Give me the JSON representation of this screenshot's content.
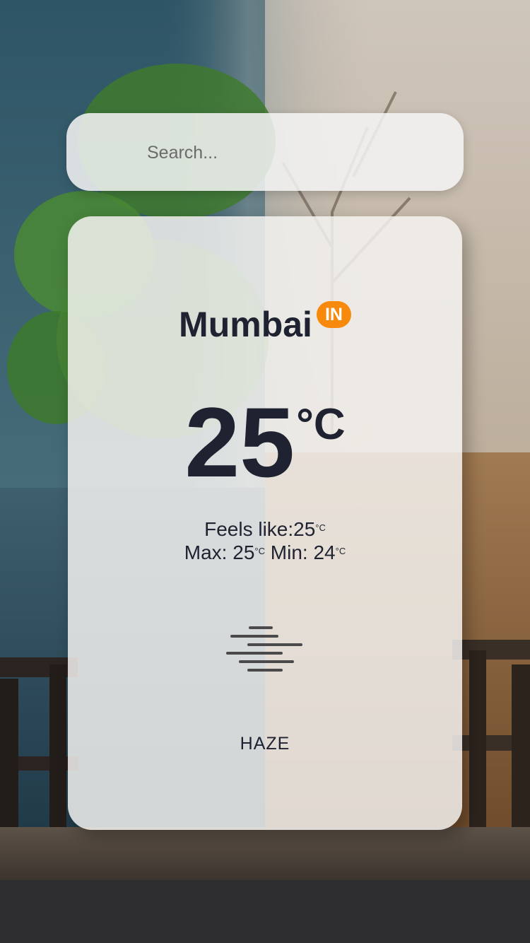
{
  "search": {
    "placeholder": "Search..."
  },
  "weather": {
    "city": "Mumbai",
    "country": "IN",
    "temperature": "25",
    "temperature_unit": "°C",
    "feels_like_label": "Feels like:",
    "feels_like_value": "25",
    "max_label": "Max:",
    "max_value": "25",
    "min_label": "Min:",
    "min_value": "24",
    "small_unit": "°C",
    "condition": "HAZE",
    "icon": "haze-icon"
  },
  "colors": {
    "badge": "#f78a0c",
    "text": "#1f2230",
    "card": "#f5f4f2"
  }
}
